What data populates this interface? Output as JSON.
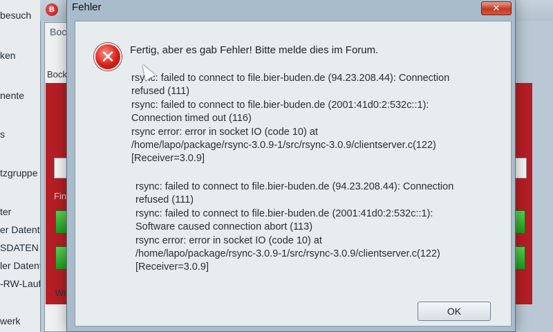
{
  "background": {
    "sidebar": {
      "items": [
        "besuch",
        "ken",
        "nente",
        "s",
        "tzgruppe",
        "ter",
        "er Datent",
        "SDATEN (",
        "ler Datent",
        "-RW-Laufv",
        "werk"
      ]
    },
    "window": {
      "app_icon": "B",
      "tab_label": "Boc",
      "section_label": "Bock",
      "finis_label": "Finis",
      "willi_label": "Willi"
    }
  },
  "dialog": {
    "title": "Fehler",
    "close_label": "✕",
    "icon": "error-icon",
    "headline": "Fertig, aber es gab Fehler! Bitte melde dies im Forum.",
    "log_block_1": [
      "rsync: failed to connect to file.bier-buden.de (94.23.208.44): Connection",
      "refused (111)",
      "rsync: failed to connect to file.bier-buden.de (2001:41d0:2:532c::1):",
      "Connection timed out (116)",
      "rsync error: error in socket IO (code 10) at",
      "/home/lapo/package/rsync-3.0.9-1/src/rsync-3.0.9/clientserver.c(122)",
      "[Receiver=3.0.9]"
    ],
    "log_block_2": [
      "rsync: failed to connect to file.bier-buden.de (94.23.208.44): Connection",
      "refused (111)",
      "rsync: failed to connect to file.bier-buden.de (2001:41d0:2:532c::1):",
      "Software caused connection abort (113)",
      "rsync error: error in socket IO (code 10) at",
      "/home/lapo/package/rsync-3.0.9-1/src/rsync-3.0.9/clientserver.c(122)",
      "[Receiver=3.0.9]"
    ],
    "ok_label": "OK"
  }
}
